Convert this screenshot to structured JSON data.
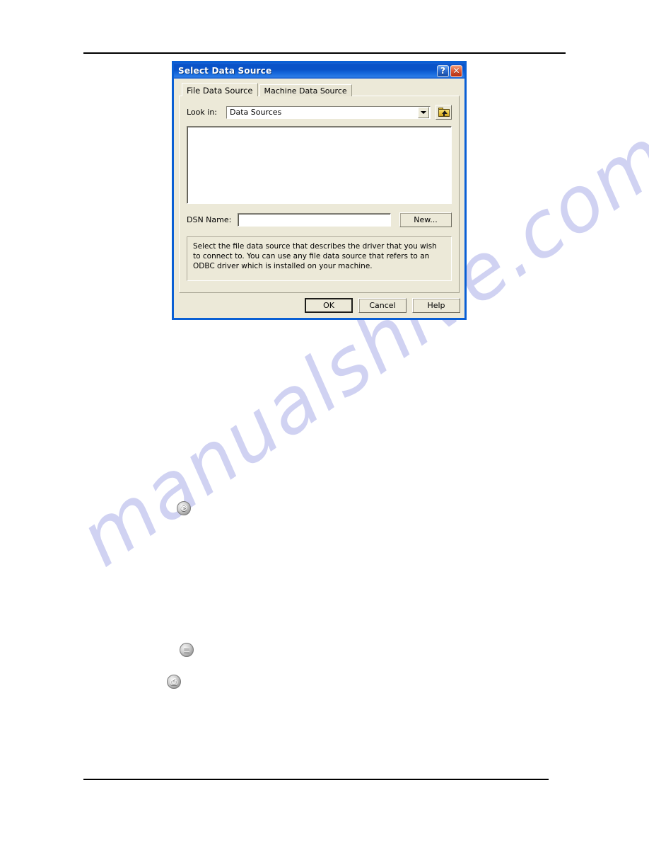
{
  "page": {
    "watermark": "manualshive.com",
    "icons": [
      {
        "name": "circular-glyph-icon-1",
        "glyph": "℗"
      },
      {
        "name": "circular-glyph-icon-2",
        "glyph": "≡"
      },
      {
        "name": "circular-glyph-icon-3",
        "glyph": "⎙"
      }
    ]
  },
  "dialog": {
    "title": "Select Data Source",
    "titlebar": {
      "help_label": "?",
      "close_label": "✕"
    },
    "tabs": [
      {
        "label": "File Data Source",
        "active": true
      },
      {
        "label": "Machine Data Source",
        "active": false
      }
    ],
    "look_in": {
      "label": "Look in:",
      "value": "Data Sources",
      "up_button_title": "Up One Level"
    },
    "file_list": {
      "items": []
    },
    "dsn": {
      "label": "DSN Name:",
      "value": "",
      "new_button": "New..."
    },
    "description": "Select the file data source that describes the driver that you wish to connect to. You can use any file data source that refers to an ODBC driver which is installed on your machine.",
    "buttons": {
      "ok": "OK",
      "cancel": "Cancel",
      "help": "Help"
    }
  }
}
